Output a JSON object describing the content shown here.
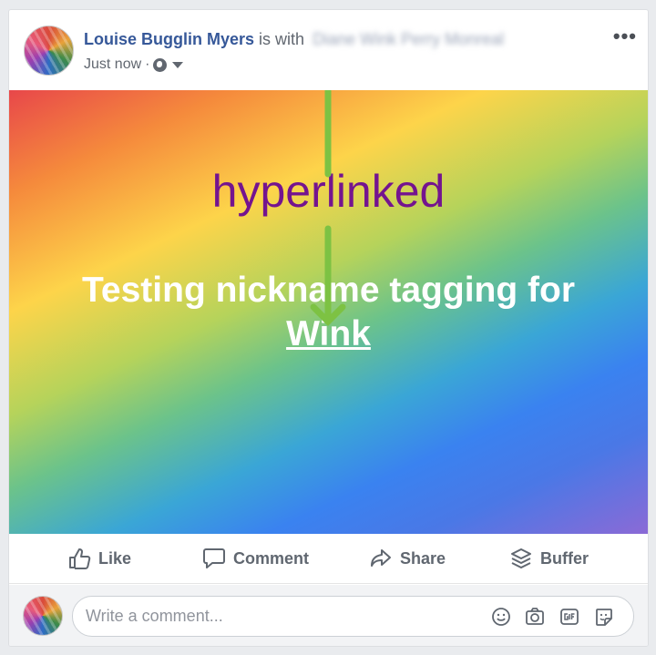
{
  "post": {
    "author": "Louise Bugglin Myers",
    "with_text": "is with",
    "tagged_names_blurred": "Diane Wink Perry Monreal",
    "timestamp": "Just now",
    "separator": "·",
    "more_label": "•••"
  },
  "banner": {
    "annotation": "hyperlinked",
    "text_line1": "Testing nickname tagging for",
    "mention": "Wink",
    "annotation_color": "#74148f",
    "arrow_color": "#7dc243"
  },
  "actions": {
    "like": "Like",
    "comment": "Comment",
    "share": "Share",
    "buffer": "Buffer"
  },
  "comment": {
    "placeholder": "Write a comment..."
  },
  "colors": {
    "author": "#365899",
    "action_text": "#606770",
    "page_bg": "#e9ebee"
  }
}
